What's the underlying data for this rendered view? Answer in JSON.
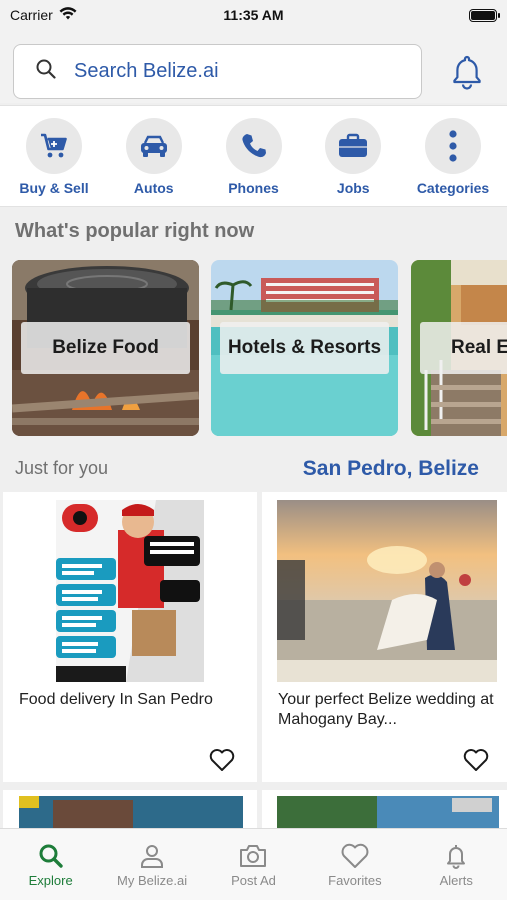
{
  "status_bar": {
    "carrier": "Carrier",
    "time": "11:35 AM"
  },
  "search": {
    "placeholder": "Search Belize.ai"
  },
  "categories": [
    {
      "label": "Buy & Sell",
      "icon": "cart-icon"
    },
    {
      "label": "Autos",
      "icon": "car-icon"
    },
    {
      "label": "Phones",
      "icon": "phone-icon"
    },
    {
      "label": "Jobs",
      "icon": "briefcase-icon"
    },
    {
      "label": "Categories",
      "icon": "more-vertical-icon"
    }
  ],
  "popular": {
    "title": "What's popular right now",
    "items": [
      {
        "label": "Belize Food"
      },
      {
        "label": "Hotels & Resorts"
      },
      {
        "label": "Real Estate"
      }
    ]
  },
  "just_for_you": {
    "title": "Just for you",
    "location": "San Pedro, Belize",
    "listings": [
      {
        "title": "Food delivery In San Pedro"
      },
      {
        "title": "Your perfect Belize wedding at Mahogany Bay..."
      }
    ]
  },
  "tab_bar": [
    {
      "label": "Explore",
      "icon": "search-icon",
      "active": true
    },
    {
      "label": "My Belize.ai",
      "icon": "person-icon",
      "active": false
    },
    {
      "label": "Post Ad",
      "icon": "camera-icon",
      "active": false
    },
    {
      "label": "Favorites",
      "icon": "heart-icon",
      "active": false
    },
    {
      "label": "Alerts",
      "icon": "bell-icon",
      "active": false
    }
  ],
  "colors": {
    "accent": "#2e5aa8",
    "active_tab": "#1e7d3a",
    "muted": "#8a8a8a"
  }
}
